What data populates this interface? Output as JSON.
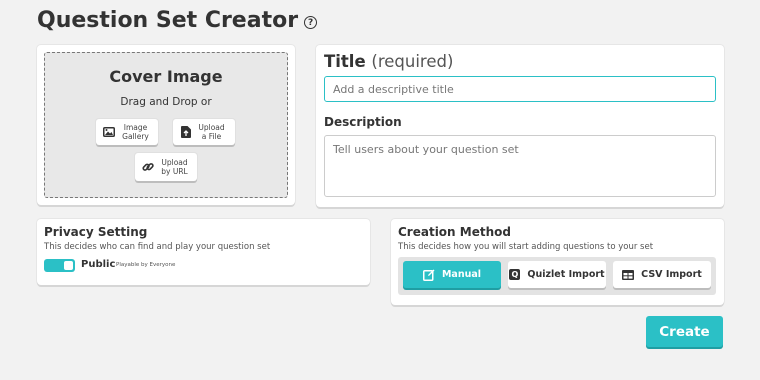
{
  "header": {
    "title": "Question Set Creator",
    "help_icon": "?"
  },
  "cover": {
    "title": "Cover Image",
    "subtitle": "Drag and Drop or",
    "buttons": {
      "gallery": {
        "line1": "Image",
        "line2": "Gallery",
        "icon": "image-icon"
      },
      "file": {
        "line1": "Upload",
        "line2": "a File",
        "icon": "file-upload-icon"
      },
      "url": {
        "line1": "Upload",
        "line2": "by URL",
        "icon": "link-icon"
      }
    }
  },
  "details": {
    "title_label": "Title",
    "title_required": "(required)",
    "title_placeholder": "Add a descriptive title",
    "title_value": "",
    "description_label": "Description",
    "description_placeholder": "Tell users about your question set",
    "description_value": ""
  },
  "privacy": {
    "title": "Privacy Setting",
    "subtitle": "This decides who can find and play your question set",
    "toggle_on": true,
    "value_label": "Public",
    "value_desc": "Playable by Everyone"
  },
  "creation": {
    "title": "Creation Method",
    "subtitle": "This decides how you will start adding questions to your set",
    "methods": [
      {
        "label": "Manual",
        "icon": "edit-icon",
        "selected": true
      },
      {
        "label": "Quizlet Import",
        "icon": "quizlet-icon",
        "icon_letter": "Q",
        "selected": false
      },
      {
        "label": "CSV Import",
        "icon": "table-icon",
        "selected": false
      }
    ]
  },
  "actions": {
    "create_label": "Create"
  },
  "colors": {
    "accent": "#2bc0c6",
    "background": "#f2f2f2",
    "text": "#333333"
  }
}
